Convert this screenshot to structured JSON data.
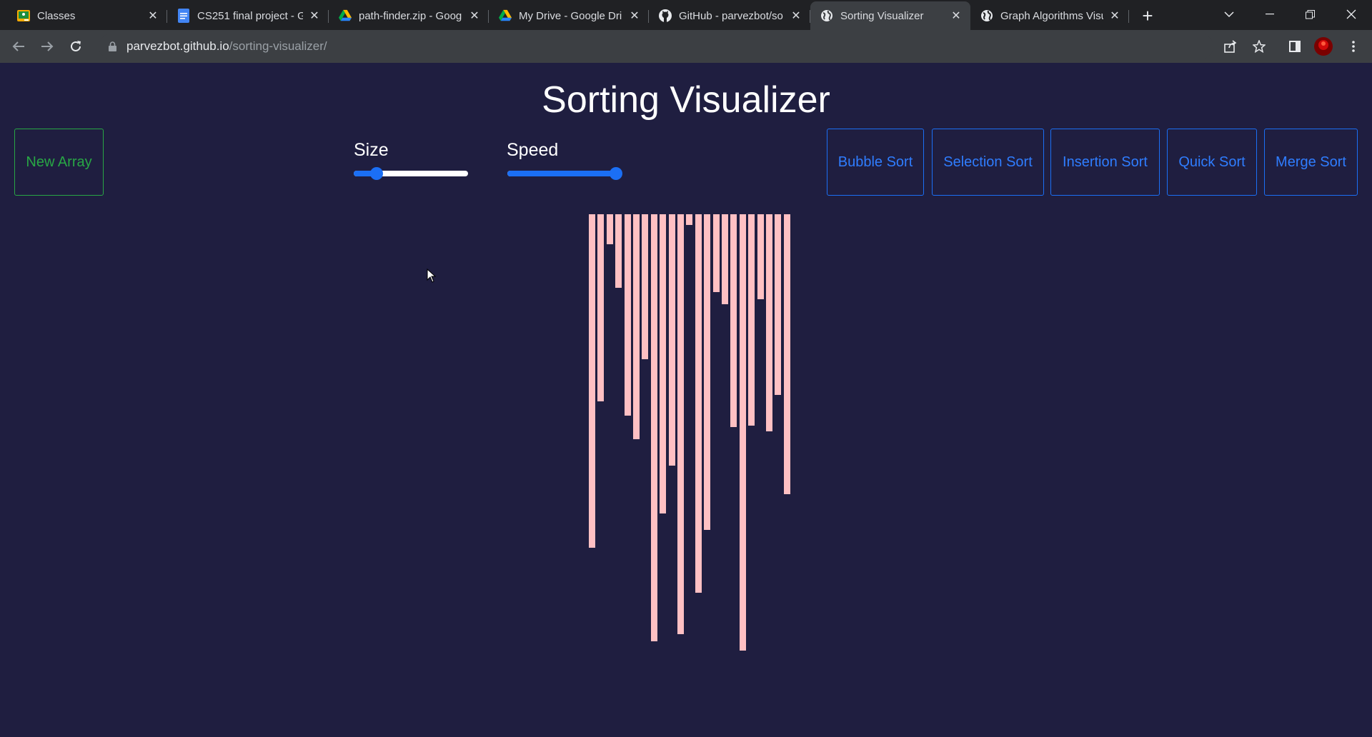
{
  "browser": {
    "tabs": [
      {
        "title": "Classes",
        "icon": "google-classroom-icon",
        "active": false
      },
      {
        "title": "CS251 final project - G",
        "icon": "google-docs-icon",
        "active": false
      },
      {
        "title": "path-finder.zip - Goog",
        "icon": "google-drive-icon",
        "active": false
      },
      {
        "title": "My Drive - Google Dri",
        "icon": "google-drive-icon",
        "active": false
      },
      {
        "title": "GitHub - parvezbot/so",
        "icon": "github-icon",
        "active": false
      },
      {
        "title": "Sorting Visualizer",
        "icon": "globe-icon",
        "active": true
      },
      {
        "title": "Graph Algorithms Visu",
        "icon": "globe-icon",
        "active": false
      }
    ],
    "url_host": "parvezbot.github.io",
    "url_path": "/sorting-visualizer/"
  },
  "page": {
    "title": "Sorting Visualizer",
    "new_array_label": "New Array",
    "size_label": "Size",
    "speed_label": "Speed",
    "size_value": 0.2,
    "speed_value": 0.95,
    "algorithm_buttons": [
      "Bubble Sort",
      "Selection Sort",
      "Insertion Sort",
      "Quick Sort",
      "Merge Sort"
    ],
    "bar_color": "#ffc0c3",
    "accent_blue": "#1b6ff5",
    "accent_green": "#28a745",
    "array_values": [
      467,
      262,
      42,
      103,
      282,
      315,
      203,
      598,
      419,
      352,
      588,
      15,
      530,
      442,
      109,
      126,
      298,
      611,
      296,
      119,
      304,
      253,
      392
    ]
  }
}
